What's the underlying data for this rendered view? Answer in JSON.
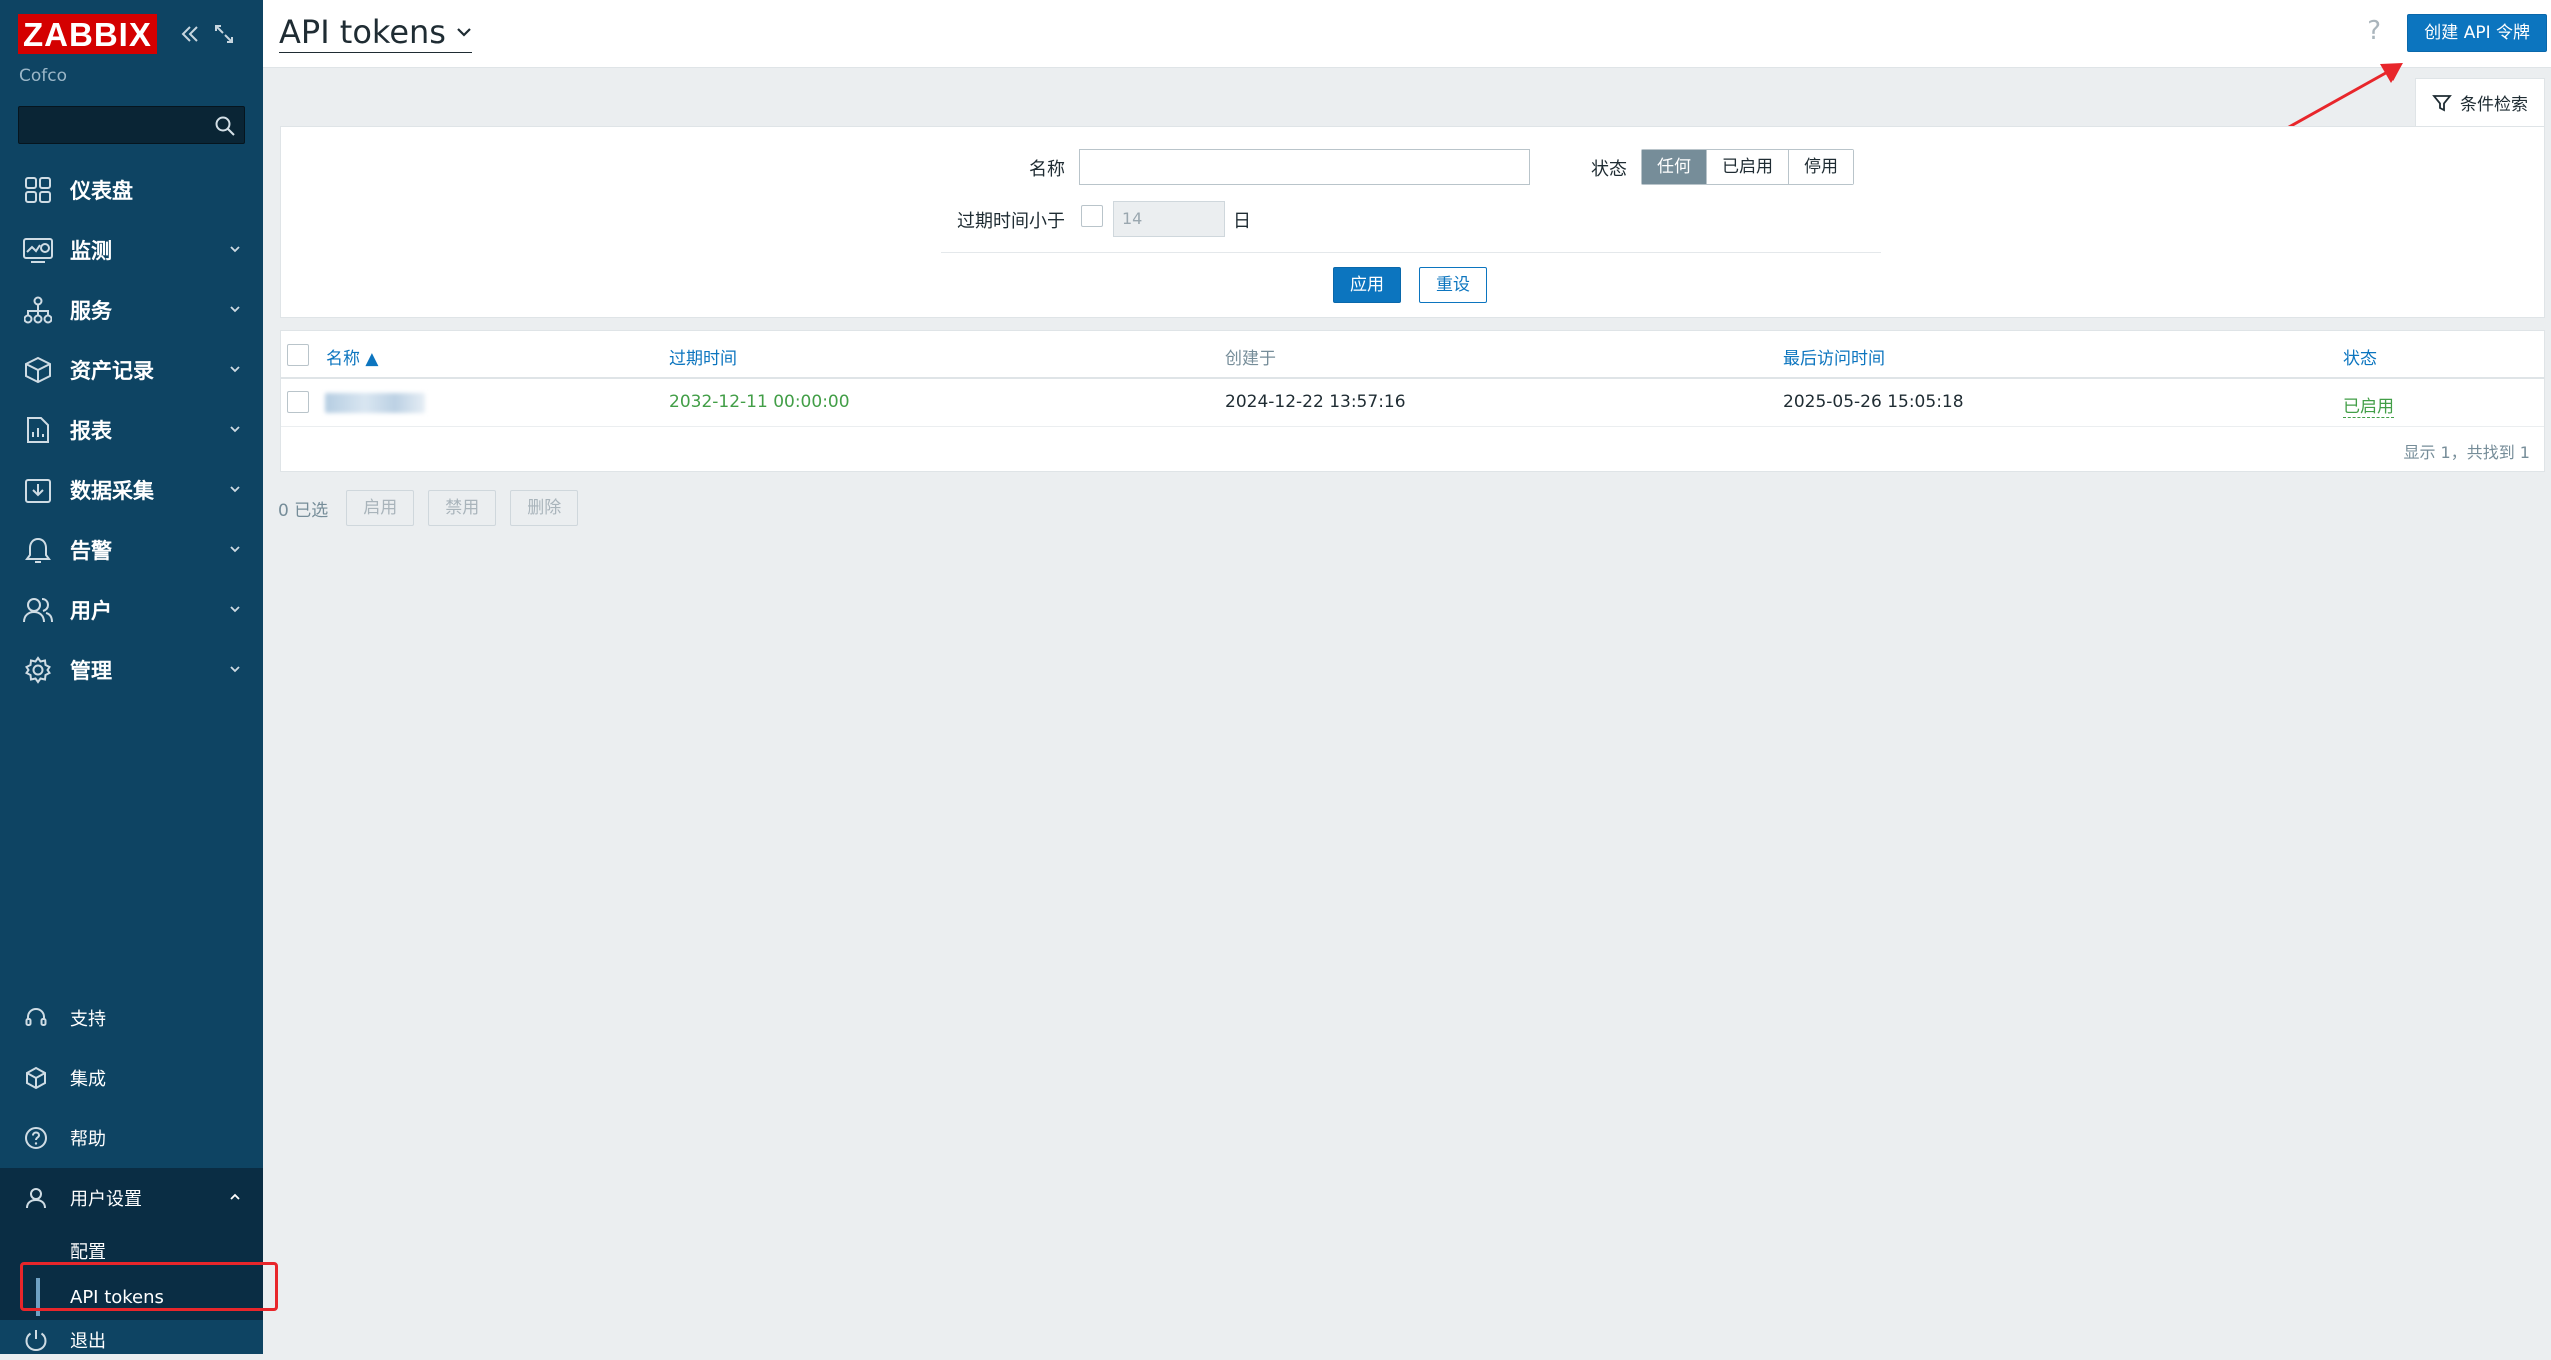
{
  "app": {
    "logo_text": "ZABBIX",
    "server_name": "Cofco"
  },
  "sidebar": {
    "search_placeholder": "",
    "items": [
      {
        "label": "仪表盘",
        "icon": "dashboard-icon"
      },
      {
        "label": "监测",
        "icon": "monitoring-icon"
      },
      {
        "label": "服务",
        "icon": "services-icon"
      },
      {
        "label": "资产记录",
        "icon": "inventory-icon"
      },
      {
        "label": "报表",
        "icon": "reports-icon"
      },
      {
        "label": "数据采集",
        "icon": "data-collection-icon"
      },
      {
        "label": "告警",
        "icon": "alerts-icon"
      },
      {
        "label": "用户",
        "icon": "users-icon"
      },
      {
        "label": "管理",
        "icon": "administration-icon"
      }
    ],
    "bottom": {
      "support": "支持",
      "integrations": "集成",
      "help": "帮助",
      "user_settings": "用户设置",
      "sub_profile": "配置",
      "sub_api_tokens": "API tokens",
      "sign_out": "退出"
    }
  },
  "header": {
    "title": "API tokens",
    "help": "?",
    "create_button": "创建 API 令牌",
    "filter_tab": "条件检索"
  },
  "filter": {
    "name_label": "名称",
    "name_value": "",
    "status_label": "状态",
    "status_options": [
      "任何",
      "已启用",
      "停用"
    ],
    "status_selected": "任何",
    "expires_label": "过期时间小于",
    "expires_days": "14",
    "days_unit": "日",
    "apply": "应用",
    "reset": "重设"
  },
  "table": {
    "columns": {
      "name": "名称 ▲",
      "expires_at": "过期时间",
      "created_at": "创建于",
      "last_accessed": "最后访问时间",
      "status": "状态"
    },
    "rows": [
      {
        "expires_at": "2032-12-11 00:00:00",
        "created_at": "2024-12-22 13:57:16",
        "last_accessed": "2025-05-26 15:05:18",
        "status": "已启用"
      }
    ],
    "footer": "显示 1，共找到 1"
  },
  "actions": {
    "selected": "0 已选",
    "enable": "启用",
    "disable": "禁用",
    "delete": "删除"
  },
  "colors": {
    "sidebar_bg": "#0e4463",
    "accent": "#0c75bf",
    "logo_red": "#d40000",
    "annotation_red": "#e8262b",
    "status_green": "#429e47"
  }
}
